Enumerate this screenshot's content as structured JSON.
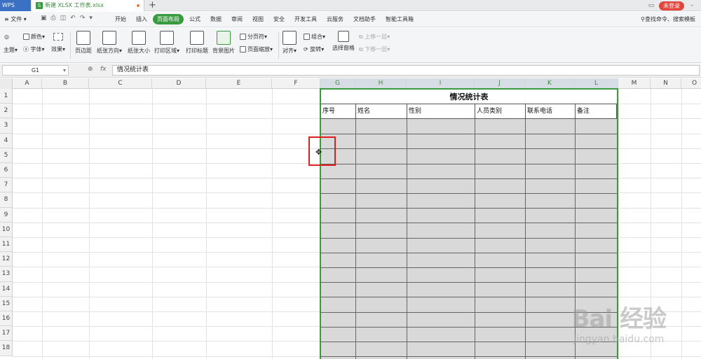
{
  "titlebar": {
    "app_name": "WPS",
    "doc_tab": "新建 XLSX 工作表.xlsx",
    "login": "未登录"
  },
  "menubar": {
    "file": "文件",
    "items": [
      "开始",
      "插入",
      "页面布局",
      "公式",
      "数据",
      "审阅",
      "视图",
      "安全",
      "开发工具",
      "云服务",
      "文档助手",
      "智能工具箱"
    ],
    "active": "页面布局",
    "search": "查找命令、搜索模板"
  },
  "ribbon": {
    "theme": "主题",
    "color": "颜色",
    "font": "字体",
    "effect": "效果",
    "margins": "页边距",
    "orientation": "纸张方向",
    "size": "纸张大小",
    "print_area": "打印区域",
    "print_titles": "打印标题",
    "bg_image": "背景图片",
    "page_break": "分页符",
    "page_zoom": "页面缩放",
    "align": "对齐",
    "group": "组合",
    "rotate": "旋转",
    "selection_pane": "选择窗格",
    "bring_forward": "上移一层",
    "send_backward": "下移一层"
  },
  "formula": {
    "cell_ref": "G1",
    "fx": "fx",
    "content": "情况统计表"
  },
  "grid": {
    "columns": [
      "A",
      "B",
      "C",
      "D",
      "E",
      "F",
      "G",
      "H",
      "I",
      "J",
      "K",
      "L",
      "M",
      "N",
      "O"
    ],
    "rows": [
      "1",
      "2",
      "3",
      "4",
      "5",
      "6",
      "7",
      "8",
      "9",
      "10",
      "11",
      "12",
      "13",
      "14",
      "15",
      "16",
      "17",
      "18"
    ]
  },
  "table": {
    "title": "情况统计表",
    "headers": [
      "序号",
      "姓名",
      "性别",
      "人员类别",
      "联系电话",
      "备注"
    ]
  },
  "watermark": {
    "main": "Bai 经验",
    "sub": "jingyan.baidu.com"
  }
}
